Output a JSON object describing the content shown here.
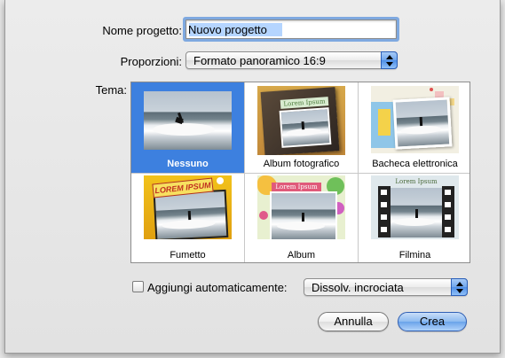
{
  "form": {
    "name_label": "Nome progetto:",
    "name_value": "Nuovo progetto",
    "ratio_label": "Proporzioni:",
    "ratio_value": "Formato panoramico 16:9",
    "theme_label": "Tema:"
  },
  "themes": [
    {
      "label": "Nessuno",
      "selected": true
    },
    {
      "label": "Album fotografico",
      "selected": false,
      "overlay_text": "Lorem Ipsum"
    },
    {
      "label": "Bacheca elettronica",
      "selected": false
    },
    {
      "label": "Fumetto",
      "selected": false,
      "overlay_text": "LOREM IPSUM"
    },
    {
      "label": "Album",
      "selected": false,
      "overlay_text": "Lorem Ipsum"
    },
    {
      "label": "Filmina",
      "selected": false,
      "overlay_text": "Lorem Ipsum"
    }
  ],
  "auto": {
    "checkbox_label": "Aggiungi automaticamente:",
    "checked": false,
    "transition_value": "Dissolv. incrociata"
  },
  "buttons": {
    "cancel": "Annulla",
    "create": "Crea"
  },
  "colors": {
    "accent": "#3d80df",
    "focus_ring": "#7fa9e0"
  },
  "icons": [
    "popup-arrows-icon"
  ]
}
